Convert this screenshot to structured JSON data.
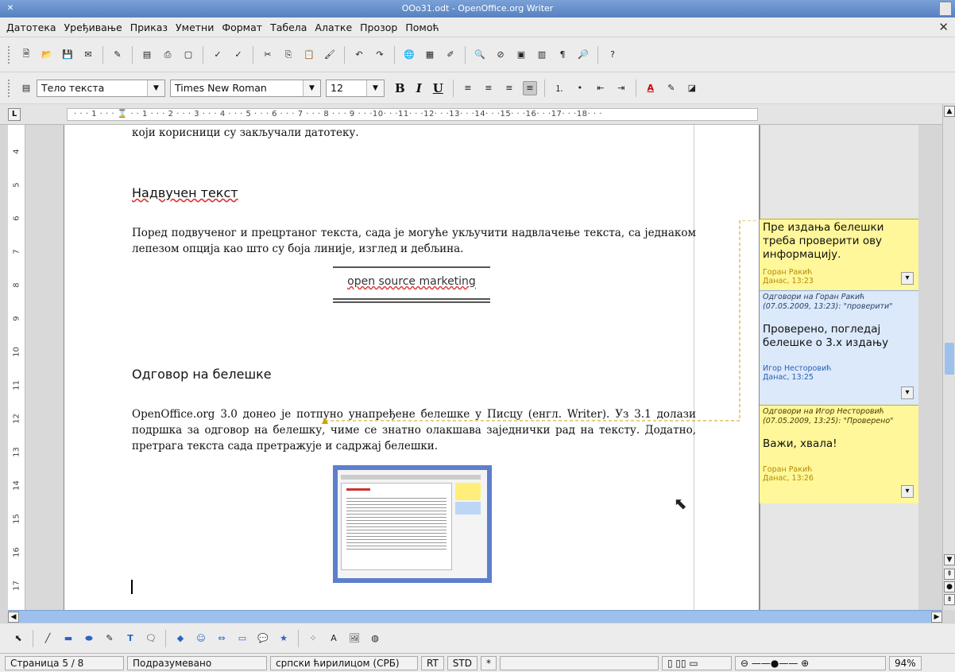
{
  "window": {
    "title": "OOo31.odt - OpenOffice.org Writer"
  },
  "menu": [
    "Датотека",
    "Уређивање",
    "Приказ",
    "Уметни",
    "Формат",
    "Табела",
    "Алатке",
    "Прозор",
    "Помоћ"
  ],
  "formatting": {
    "style": "Тело текста",
    "font": "Times New Roman",
    "size": "12"
  },
  "ruler": {
    "scale_text": "· · · 1 · · · ⌛ · · 1 · · · 2 · · · 3 · · · 4 · · · 5 · · · 6 · · · 7 · · · 8 · · · 9 · · ·10· · ·11· · ·12· · ·13· · ·14· · ·15· · ·16· · ·17· · ·18· · ·"
  },
  "vruler": [
    "4",
    "5",
    "6",
    "7",
    "8",
    "9",
    "10",
    "11",
    "12",
    "13",
    "14",
    "15",
    "16",
    "17"
  ],
  "document": {
    "line_top": "који корисници су закључали датотеку.",
    "h1": "Надвучен текст",
    "p1": "Поред подвученог и прецртаног текста, сада је могуће укључити надвлачење текста, са једнаком лепезом опција као што су боја линије, изглед и дебљина.",
    "sample": "open source marketing",
    "h2": "Одговор на белешке",
    "p2": "OpenOffice.org 3.0 донео је потпуно унапређене белешке у Писцу (енгл. Writer). Уз 3.1 долази подршка за одговор на белешку, чиме се знатно олакшава заједнички рад на тексту. Додатно, претрага текста сада претражује и садржај белешки."
  },
  "notes": [
    {
      "body": "Пре издања белешки треба проверити ову информацију.",
      "author": "Горан Ракић",
      "time": "Данас, 13:23",
      "reply": "",
      "bg": "#fff79a",
      "fg": "#b38b00"
    },
    {
      "reply": "Одговори на  Горан Ракић (07.05.2009, 13:23): \"проверити\"",
      "body": "Проверено, погледај белешке о 3.х издању",
      "author": "Игор Несторовић",
      "time": "Данас, 13:25",
      "bg": "#dbe9fb",
      "fg": "#2a5fb0"
    },
    {
      "reply": "Одговори на  Игор Несторовић (07.05.2009, 13:25): \"Проверено\"",
      "body": "Важи, хвала!",
      "author": "Горан Ракић",
      "time": "Данас, 13:26",
      "bg": "#fff79a",
      "fg": "#b38b00"
    }
  ],
  "status": {
    "page": "Страница 5 / 8",
    "style": "Подразумевано",
    "lang": "српски ћирилицом (СРБ)",
    "mode1": "RT",
    "mode2": "STD",
    "mode3": "*",
    "zoom": "94%"
  }
}
